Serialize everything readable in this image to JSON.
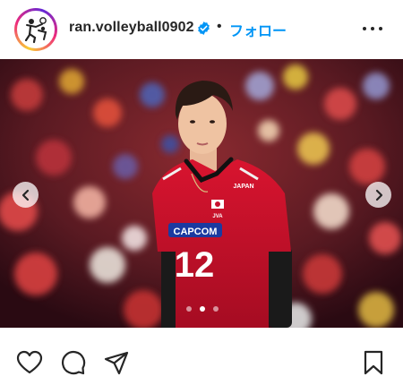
{
  "header": {
    "username": "ran.volleyball0902",
    "separator": "•",
    "follow_label": "フォロー",
    "avatar_icon": "volleyball-player-avatar",
    "verified_icon": "verified-badge-icon",
    "more_icon": "more-options-icon"
  },
  "post": {
    "jersey_sponsor": "CAPCOM",
    "jersey_number": "12",
    "jersey_brand": "JAPAN",
    "jersey_federation": "JVA",
    "carousel": {
      "current_index": 2,
      "total": 3
    },
    "nav": {
      "prev_icon": "chevron-left-icon",
      "next_icon": "chevron-right-icon"
    }
  },
  "actions": {
    "like_icon": "heart-icon",
    "comment_icon": "comment-bubble-icon",
    "share_icon": "paper-plane-icon",
    "save_icon": "bookmark-icon"
  },
  "colors": {
    "follow": "#0095f6",
    "verified": "#0095f6",
    "jersey": "#c8102e",
    "text": "#262626"
  }
}
